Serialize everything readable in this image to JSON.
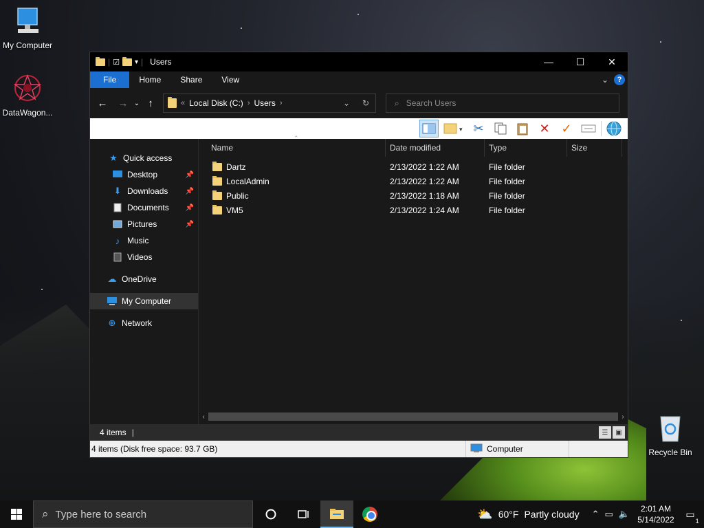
{
  "desktop": {
    "icons": [
      {
        "label": "My Computer"
      },
      {
        "label": "DataWagon..."
      },
      {
        "label": "Recycle Bin"
      }
    ]
  },
  "window": {
    "title": "Users",
    "controls": {
      "minimize": "—",
      "maximize": "☐",
      "close": "✕"
    }
  },
  "ribbon": {
    "tabs": [
      "File",
      "Home",
      "Share",
      "View"
    ],
    "help": "?"
  },
  "address": {
    "prefix": "«",
    "crumbs": [
      "Local Disk (C:)",
      "Users"
    ],
    "separator": "›"
  },
  "search": {
    "placeholder": "Search Users"
  },
  "nav": {
    "quick_access": "Quick access",
    "items": [
      {
        "label": "Desktop",
        "pinned": true
      },
      {
        "label": "Downloads",
        "pinned": true
      },
      {
        "label": "Documents",
        "pinned": true
      },
      {
        "label": "Pictures",
        "pinned": true
      },
      {
        "label": "Music",
        "pinned": false
      },
      {
        "label": "Videos",
        "pinned": false
      }
    ],
    "onedrive": "OneDrive",
    "my_computer": "My Computer",
    "network": "Network"
  },
  "columns": {
    "name": "Name",
    "date": "Date modified",
    "type": "Type",
    "size": "Size"
  },
  "files": [
    {
      "name": "Dartz",
      "date": "2/13/2022 1:22 AM",
      "type": "File folder"
    },
    {
      "name": "LocalAdmin",
      "date": "2/13/2022 1:22 AM",
      "type": "File folder"
    },
    {
      "name": "Public",
      "date": "2/13/2022 1:18 AM",
      "type": "File folder"
    },
    {
      "name": "VM5",
      "date": "2/13/2022 1:24 AM",
      "type": "File folder"
    }
  ],
  "status": {
    "count": "4 items",
    "detail": "4 items (Disk free space: 93.7 GB)",
    "location": "Computer"
  },
  "taskbar": {
    "search_placeholder": "Type here to search",
    "weather_temp": "60°F",
    "weather_desc": "Partly cloudy",
    "time": "2:01 AM",
    "date": "5/14/2022",
    "notifications": "1"
  }
}
